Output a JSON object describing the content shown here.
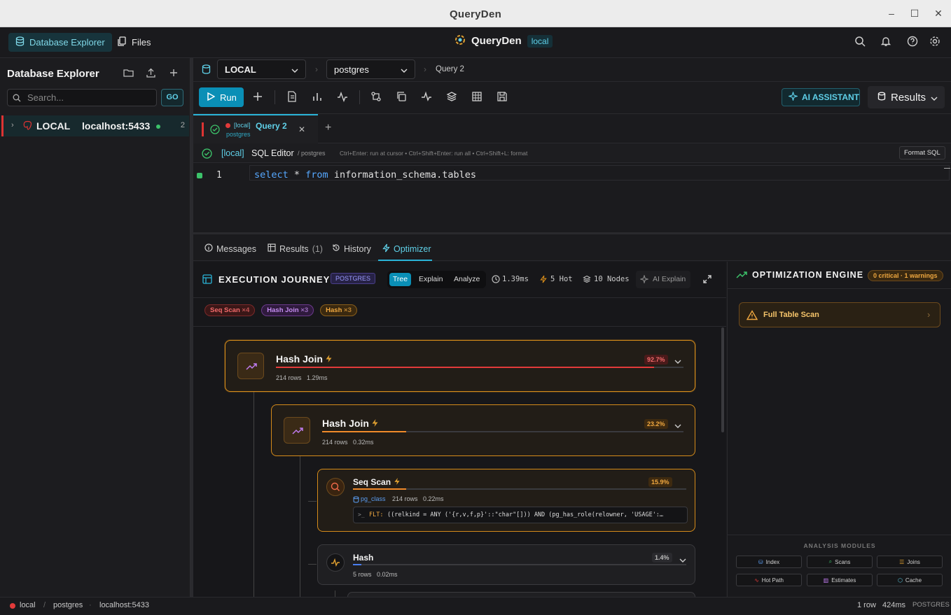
{
  "window": {
    "title": "QueryDen"
  },
  "header": {
    "tabs": [
      {
        "label": "Database Explorer"
      },
      {
        "label": "Files"
      }
    ],
    "brand": "QueryDen",
    "env": "local"
  },
  "sidebar": {
    "title": "Database Explorer",
    "search_placeholder": "Search...",
    "go_label": "GO",
    "connection": {
      "name": "LOCAL",
      "host": "localhost:5433",
      "count": "2"
    }
  },
  "context": {
    "connection": "LOCAL",
    "database": "postgres",
    "query": "Query 2"
  },
  "toolbar": {
    "run_label": "Run",
    "ai_label": "AI ASSISTANT",
    "results_label": "Results"
  },
  "query_tab": {
    "prefix": "[local]",
    "name": "Query 2",
    "db": "postgres"
  },
  "editor": {
    "prefix": "[local]",
    "title": "SQL Editor",
    "db": "/ postgres",
    "hint": "Ctrl+Enter: run at cursor • Ctrl+Shift+Enter: run all • Ctrl+Shift+L: format",
    "format_label": "Format SQL",
    "line_number": "1",
    "code_kw1": "select",
    "code_rest1": " * ",
    "code_kw2": "from",
    "code_rest2": " information_schema.tables"
  },
  "bottom_tabs": {
    "messages": "Messages",
    "results": "Results",
    "results_count": "(1)",
    "history": "History",
    "optimizer": "Optimizer"
  },
  "journey": {
    "title": "EXECUTION JOURNEY",
    "engine": "POSTGRES",
    "modes": [
      "Tree",
      "Explain",
      "Analyze"
    ],
    "time": "1.39ms",
    "hot": "5 Hot",
    "nodes": "10 Nodes",
    "ai_explain": "AI Explain",
    "chips": [
      {
        "label": "Seq Scan",
        "count": "×4"
      },
      {
        "label": "Hash Join",
        "count": "×3"
      },
      {
        "label": "Hash",
        "count": "×3"
      }
    ],
    "plan_nodes": [
      {
        "name": "Hash Join",
        "rows": "214 rows",
        "time": "1.29ms",
        "pct": "92.7%",
        "fill": 0.927
      },
      {
        "name": "Hash Join",
        "rows": "214 rows",
        "time": "0.32ms",
        "pct": "23.2%",
        "fill": 0.232
      },
      {
        "name": "Seq Scan",
        "relation": "pg_class",
        "rows": "214 rows",
        "time": "0.22ms",
        "pct": "15.9%",
        "fill": 0.159,
        "filter_label": "FLT:",
        "filter": "((relkind = ANY ('{r,v,f,p}'::\"char\"[])) AND (pg_has_role(relowner, 'USAGE':…"
      },
      {
        "name": "Hash",
        "rows": "5 rows",
        "time": "0.02ms",
        "pct": "1.4%",
        "fill": 0.014
      }
    ]
  },
  "optimizer": {
    "title": "OPTIMIZATION ENGINE",
    "badge": "0 critical · 1 warnings",
    "finding": "Full Table Scan",
    "modules_title": "ANALYSIS MODULES",
    "modules": [
      "Index",
      "Scans",
      "Joins",
      "Hot Path",
      "Estimates",
      "Cache"
    ]
  },
  "status": {
    "env": "local",
    "db": "postgres",
    "host": "localhost:5433",
    "rows": "1 row",
    "time": "424ms",
    "engine": "POSTGRES"
  },
  "colors": {
    "accent": "#0a8fb6",
    "warn": "#d58b1a",
    "danger": "#e23a3a"
  }
}
